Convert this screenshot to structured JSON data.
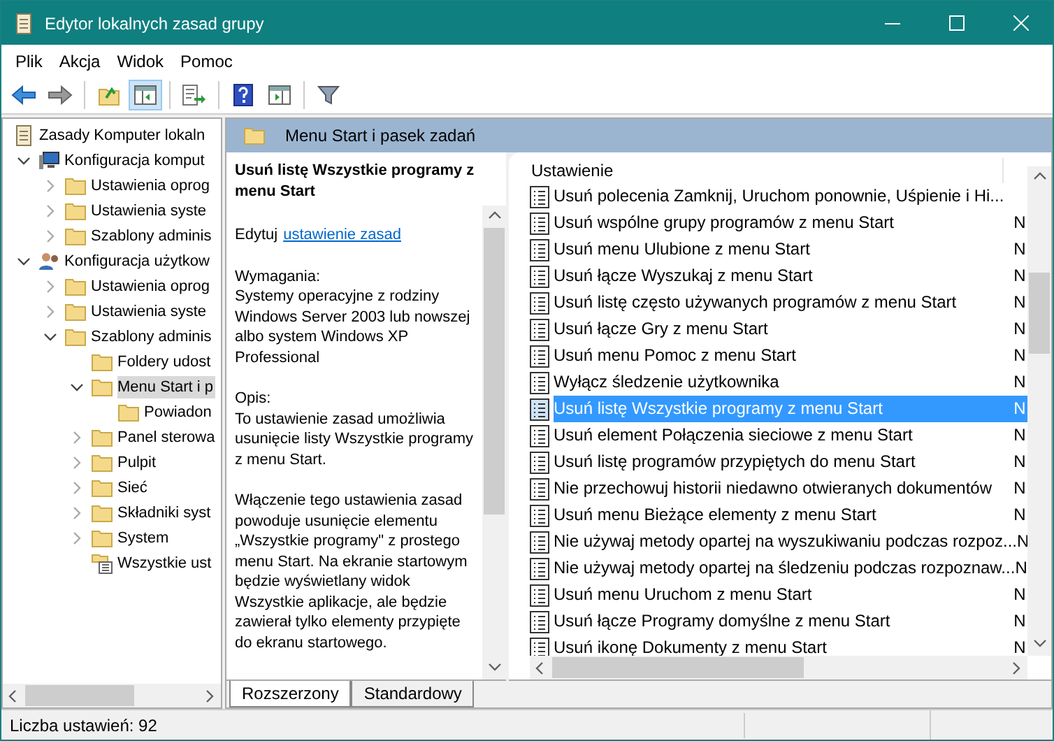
{
  "window": {
    "title": "Edytor lokalnych zasad grupy"
  },
  "menu": [
    "Plik",
    "Akcja",
    "Widok",
    "Pomoc"
  ],
  "toolbar": [
    {
      "kind": "back",
      "selected": false
    },
    {
      "kind": "forward",
      "selected": false
    },
    {
      "kind": "sep"
    },
    {
      "kind": "up",
      "selected": false
    },
    {
      "kind": "tree",
      "selected": true
    },
    {
      "kind": "sep"
    },
    {
      "kind": "export",
      "selected": false
    },
    {
      "kind": "sep"
    },
    {
      "kind": "help",
      "selected": false
    },
    {
      "kind": "pane",
      "selected": false
    },
    {
      "kind": "sep"
    },
    {
      "kind": "filter",
      "selected": false
    }
  ],
  "tree": [
    {
      "label": "Zasady Komputer lokaln",
      "kind": "scroll",
      "selected": false,
      "children": [
        {
          "label": "Konfiguracja komput",
          "kind": "computer",
          "expanded": true,
          "selected": false,
          "children": [
            {
              "label": "Ustawienia oprog",
              "kind": "folder",
              "expanded": false,
              "selected": false
            },
            {
              "label": "Ustawienia syste",
              "kind": "folder",
              "expanded": false,
              "selected": false
            },
            {
              "label": "Szablony adminis",
              "kind": "folder",
              "expanded": false,
              "selected": false
            }
          ]
        },
        {
          "label": "Konfiguracja użytkow",
          "kind": "user",
          "expanded": true,
          "selected": false,
          "children": [
            {
              "label": "Ustawienia oprog",
              "kind": "folder",
              "expanded": false,
              "selected": false
            },
            {
              "label": "Ustawienia syste",
              "kind": "folder",
              "expanded": false,
              "selected": false
            },
            {
              "label": "Szablony adminis",
              "kind": "folder",
              "expanded": true,
              "selected": false,
              "children": [
                {
                  "label": "Foldery udost",
                  "kind": "folder",
                  "selected": false
                },
                {
                  "label": "Menu Start i p",
                  "kind": "folder",
                  "expanded": true,
                  "selected": true,
                  "children": [
                    {
                      "label": "Powiadon",
                      "kind": "folder",
                      "selected": false
                    }
                  ]
                },
                {
                  "label": "Panel sterowa",
                  "kind": "folder",
                  "expanded": false,
                  "selected": false
                },
                {
                  "label": "Pulpit",
                  "kind": "folder",
                  "expanded": false,
                  "selected": false
                },
                {
                  "label": "Sieć",
                  "kind": "folder",
                  "expanded": false,
                  "selected": false
                },
                {
                  "label": "Składniki syst",
                  "kind": "folder",
                  "expanded": false,
                  "selected": false
                },
                {
                  "label": "System",
                  "kind": "folder",
                  "expanded": false,
                  "selected": false
                },
                {
                  "label": "Wszystkie ust",
                  "kind": "settings",
                  "selected": false
                }
              ]
            }
          ]
        }
      ]
    }
  ],
  "header": {
    "title": "Menu Start i pasek zadań"
  },
  "description": {
    "title": "Usuń listę Wszystkie programy z menu Start",
    "edit_prefix": "Edytuj",
    "edit_link": "ustawienie zasad",
    "paragraphs": [
      "Wymagania:\nSystemy operacyjne z rodziny Windows Server 2003 lub nowszej albo system Windows XP Professional",
      "Opis:\nTo ustawienie zasad umożliwia usunięcie listy Wszystkie programy z menu Start.",
      "Włączenie tego ustawienia zasad powoduje usunięcie elementu „Wszystkie programy\" z prostego menu Start.  Na ekranie startowym będzie wyświetlany widok Wszystkie aplikacje, ale będzie zawierał tylko elementy przypięte do ekranu startowego."
    ]
  },
  "tabs": [
    {
      "label": "Rozszerzony",
      "selected": true
    },
    {
      "label": "Standardowy",
      "selected": false
    }
  ],
  "table": {
    "columns": [
      "Ustawienie"
    ],
    "rows": [
      {
        "name": "Usuń polecenia Zamknij, Uruchom ponownie, Uśpienie i Hi...",
        "column_2": "",
        "selected": false
      },
      {
        "name": "Usuń wspólne grupy programów z menu Start",
        "column_2": "N",
        "selected": false
      },
      {
        "name": "Usuń menu Ulubione z menu Start",
        "column_2": "N",
        "selected": false
      },
      {
        "name": "Usuń łącze Wyszukaj z menu Start",
        "column_2": "N",
        "selected": false
      },
      {
        "name": "Usuń listę często używanych programów z menu Start",
        "column_2": "N",
        "selected": false
      },
      {
        "name": "Usuń łącze Gry z menu Start",
        "column_2": "N",
        "selected": false
      },
      {
        "name": "Usuń menu Pomoc z menu Start",
        "column_2": "N",
        "selected": false
      },
      {
        "name": "Wyłącz śledzenie użytkownika",
        "column_2": "N",
        "selected": false
      },
      {
        "name": "Usuń listę Wszystkie programy z menu Start",
        "column_2": "N",
        "selected": true
      },
      {
        "name": "Usuń element Połączenia sieciowe z menu Start",
        "column_2": "N",
        "selected": false
      },
      {
        "name": "Usuń listę programów przypiętych do menu Start",
        "column_2": "N",
        "selected": false
      },
      {
        "name": "Nie przechowuj historii niedawno otwieranych dokumentów",
        "column_2": "N",
        "selected": false
      },
      {
        "name": "Usuń menu Bieżące elementy z menu Start",
        "column_2": "N",
        "selected": false
      },
      {
        "name": "Nie używaj metody opartej na wyszukiwaniu podczas rozpoz...",
        "column_2": "N",
        "selected": false
      },
      {
        "name": "Nie używaj metody opartej na śledzeniu podczas rozpoznaw...",
        "column_2": "N",
        "selected": false
      },
      {
        "name": "Usuń menu Uruchom z menu Start",
        "column_2": "N",
        "selected": false
      },
      {
        "name": "Usuń łącze Programy domyślne z menu Start",
        "column_2": "N",
        "selected": false
      },
      {
        "name": "Usuń ikonę Dokumenty z menu Start",
        "column_2": "N",
        "selected": false
      }
    ]
  },
  "status_bar": {
    "text": "Liczba ustawień: 92"
  }
}
